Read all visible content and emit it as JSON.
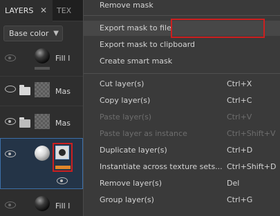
{
  "panel": {
    "tabs": [
      {
        "label": "LAYERS",
        "close": "✕"
      },
      {
        "label": "TEX"
      }
    ],
    "blend_mode": "Base color",
    "layers": [
      {
        "name": "Fill l"
      },
      {
        "name": "Mas"
      },
      {
        "name": "Mas"
      },
      {
        "name": ""
      },
      {
        "name": "Fill l"
      }
    ]
  },
  "menu": {
    "items": [
      {
        "label": "Remove mask",
        "shortcut": "",
        "disabled": false
      },
      {
        "label": "Export mask to file",
        "shortcut": "",
        "disabled": false
      },
      {
        "label": "Export mask to clipboard",
        "shortcut": "",
        "disabled": false
      },
      {
        "label": "Create smart mask",
        "shortcut": "",
        "disabled": false
      },
      {
        "label": "Cut layer(s)",
        "shortcut": "Ctrl+X",
        "disabled": false
      },
      {
        "label": "Copy layer(s)",
        "shortcut": "Ctrl+C",
        "disabled": false
      },
      {
        "label": "Paste layer(s)",
        "shortcut": "Ctrl+V",
        "disabled": true
      },
      {
        "label": "Paste layer as instance",
        "shortcut": "Ctrl+Shift+V",
        "disabled": true
      },
      {
        "label": "Duplicate layer(s)",
        "shortcut": "Ctrl+D",
        "disabled": false
      },
      {
        "label": "Instantiate across texture sets...",
        "shortcut": "Ctrl+Shift+D",
        "disabled": false
      },
      {
        "label": "Remove layer(s)",
        "shortcut": "Del",
        "disabled": false
      },
      {
        "label": "Group layer(s)",
        "shortcut": "Ctrl+G",
        "disabled": false
      }
    ]
  },
  "colors": {
    "highlight_box": "#cc1f1f",
    "selection": "#3d6fa8",
    "mask_bar": "#e0872a"
  }
}
